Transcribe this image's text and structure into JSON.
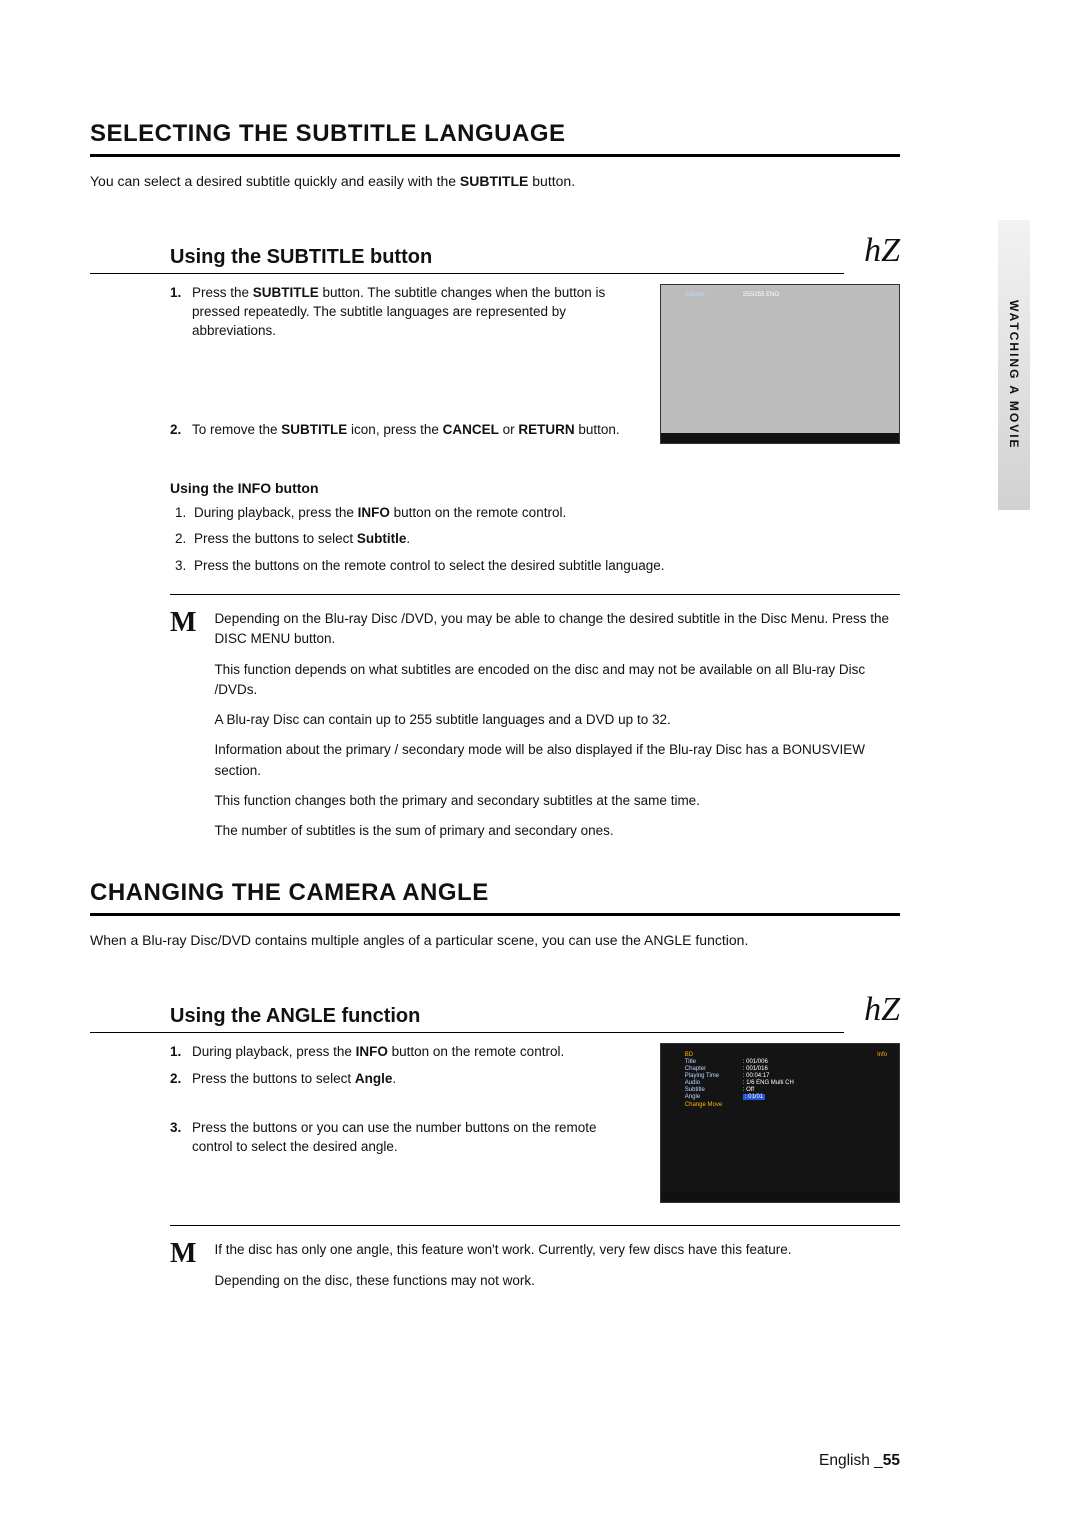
{
  "sideTab": "WATCHING A MOVIE",
  "footer": {
    "left": "English _",
    "page": "55"
  },
  "icons": {
    "hz": "hZ",
    "note": "M"
  },
  "subtitle": {
    "heading": "SELECTING THE SUBTITLE LANGUAGE",
    "intro_before": "You can select a desired subtitle quickly and easily with the ",
    "intro_bold": "SUBTITLE",
    "intro_after": " button.",
    "sub": "Using the SUBTITLE button",
    "steps": [
      {
        "n": "1.",
        "before": "Press the ",
        "b1": "SUBTITLE",
        "after": " button. The subtitle changes when the button is pressed repeatedly. The subtitle languages are represented by abbreviations."
      },
      {
        "n": "2.",
        "before": "To remove the ",
        "b1": "SUBTITLE",
        "mid": " icon, press the ",
        "b2": "CANCEL",
        "mid2": " or ",
        "b3": "RETURN",
        "after": " button."
      }
    ],
    "infoHeading": "Using the INFO button",
    "infoSteps": [
      {
        "before": "During playback, press the ",
        "b1": "INFO",
        "after": " button on the remote control."
      },
      {
        "before": "Press the ",
        "mid": " buttons to select ",
        "b2": "Subtitle",
        "after": "."
      },
      {
        "before": "Press the ",
        "after": " buttons on the remote control to select the desired subtitle language."
      }
    ],
    "notes": [
      "Depending on the Blu-ray Disc /DVD, you may be able to change the desired subtitle in the Disc Menu. Press the DISC MENU button.",
      "This function depends on what subtitles are encoded on the disc and may not be available on all Blu-ray Disc /DVDs.",
      "A Blu-ray Disc can contain up to 255 subtitle languages and a DVD up to 32.",
      "Information about the primary / secondary mode will be also displayed if the Blu-ray Disc has a BONUSVIEW section.",
      "This function changes both the primary and secondary subtitles at the same time.",
      "The number of subtitles is the sum of primary and secondary ones."
    ],
    "overlay": {
      "k": "Subtitle",
      "v": "255/255 ENG"
    }
  },
  "angle": {
    "heading": "CHANGING THE CAMERA ANGLE",
    "intro": "When a Blu-ray Disc/DVD contains multiple angles of a particular scene, you can use the ANGLE function.",
    "sub": "Using the ANGLE function",
    "steps": [
      {
        "n": "1.",
        "before": "During playback, press the ",
        "b1": "INFO",
        "after": " button on the remote control."
      },
      {
        "n": "2.",
        "before": "Press the ",
        "mid": " buttons to select ",
        "b2": "Angle",
        "after": "."
      },
      {
        "n": "3.",
        "before": "Press the ",
        "after": " buttons or you can use the number buttons on the remote control to select the desired angle."
      }
    ],
    "notes": [
      "If the disc has only one angle, this feature won't work. Currently, very few discs have this feature.",
      "Depending on the disc, these functions may not work."
    ],
    "overlay": {
      "titleLeft": "BD",
      "titleRight": "Info",
      "rows": [
        {
          "k": "Title",
          "v": ": 001/006"
        },
        {
          "k": "Chapter",
          "v": ": 001/016"
        },
        {
          "k": "Playing Time",
          "v": ": 00:04:17"
        },
        {
          "k": "Audio",
          "v": ": 1/6 ENG Multi CH"
        },
        {
          "k": "Subtitle",
          "v": ": Off"
        },
        {
          "k": "Angle",
          "v": ": 01/01",
          "hl": true
        }
      ],
      "footer": "Change    Move"
    }
  }
}
